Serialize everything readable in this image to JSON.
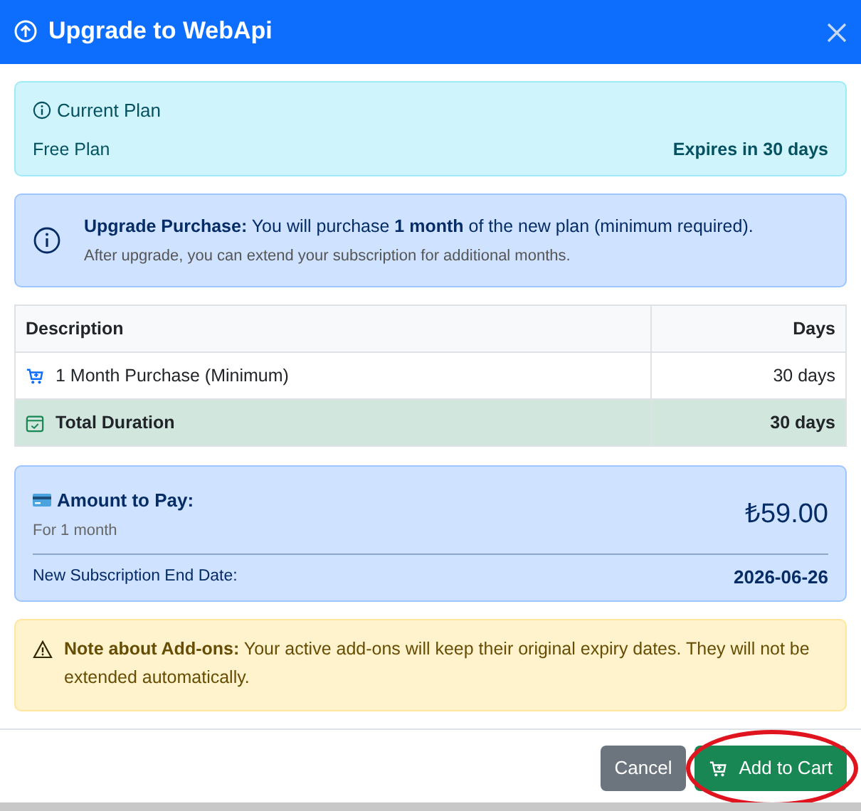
{
  "modal": {
    "title": "Upgrade to WebApi"
  },
  "current_plan": {
    "heading": "Current Plan",
    "plan": "Free Plan",
    "expiry": "Expires in 30 days"
  },
  "info": {
    "text": "**Upgrade Purchase:** You will purchase **1 month** of the new plan (minimum required).",
    "note": "After upgrade, you can extend your subscription for additional months."
  },
  "table": {
    "columns": [
      "Description",
      "Days"
    ],
    "rows": [
      {
        "kind": "item",
        "description": "1 Month Purchase (Minimum)",
        "days": "30 days"
      },
      {
        "kind": "total",
        "description": "Total Duration",
        "days": "30 days"
      }
    ]
  },
  "payment": {
    "label": "Amount to Pay:",
    "period": "For 1 month",
    "amount": "₺59.00",
    "end_date_label": "New Subscription End Date:",
    "end_date": "2026-06-26"
  },
  "warning": {
    "text": "**Note about Add-ons:** Your active add-ons will keep their original expiry dates. They will not be extended automatically."
  },
  "buttons": [
    {
      "kind": "cancel",
      "label": "Cancel",
      "highlighted": false
    },
    {
      "kind": "primary",
      "label": "Add to Cart",
      "highlighted": true
    }
  ]
}
